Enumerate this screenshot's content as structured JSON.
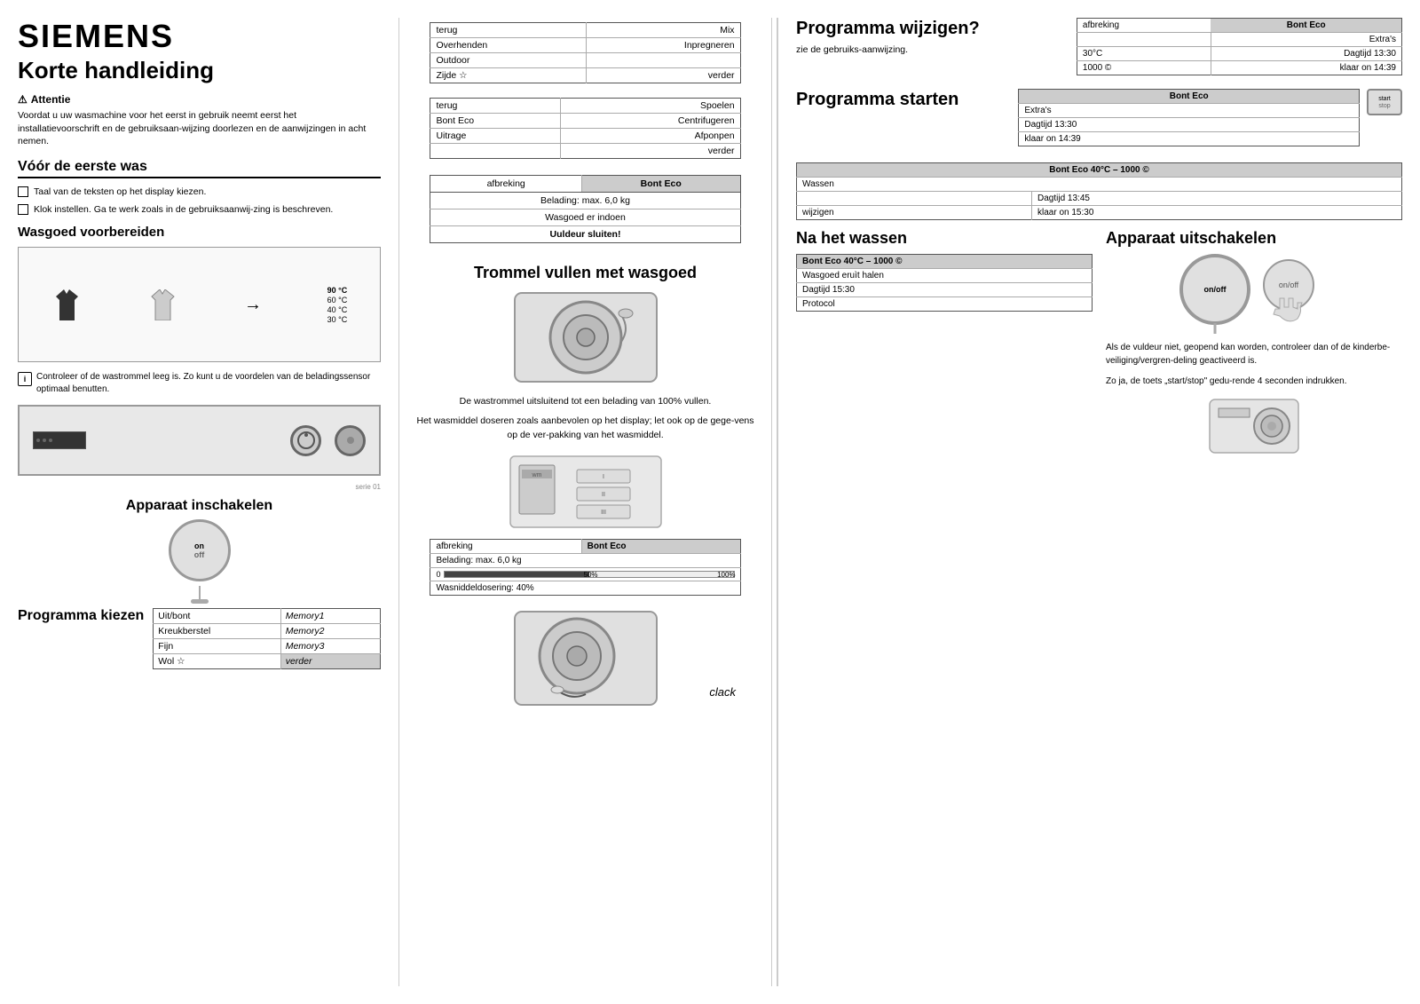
{
  "logo": "SIEMENS",
  "title": "Korte handleiding",
  "attentie": {
    "label": "Attentie",
    "text": "Voordat u uw wasmachine voor het eerst in gebruik neemt eerst het installatievoorschrift en de gebruiksaan-wijzing doorlezen en de aanwijzingen in acht nemen."
  },
  "voor_de_eerste_was": {
    "title": "Vóór de eerste was",
    "items": [
      "Taal van de teksten op het display kiezen.",
      "Klok instellen. Ga te werk zoals in de gebruiksaanwij-zing is beschreven."
    ]
  },
  "wasgoed_voorbereiden": {
    "title": "Wasgoed voorbereiden",
    "temps": [
      "90 °C",
      "60 °C",
      "40 °C",
      "30 °C"
    ],
    "control_note": "Controleer of de wastrommel leeg is. Zo kunt u de voordelen van de beladingssensor optimaal benutten."
  },
  "apparaat_inschakelen": {
    "title": "Apparaat inschakelen",
    "button_on": "on",
    "button_off": "off"
  },
  "programma_kiezen": {
    "title": "Programma kiezen",
    "rows": [
      {
        "left": "Uit/bont",
        "right": "Memory1"
      },
      {
        "left": "Kreukberstel",
        "right": "Memory2"
      },
      {
        "left": "Fijn",
        "right": "Memory3"
      },
      {
        "left": "Wol ☆",
        "right": "verder"
      }
    ]
  },
  "prog_select_top": {
    "rows": [
      {
        "left": "terug",
        "right": "Mix"
      },
      {
        "left": "Overhenden",
        "right": "Inpregneren"
      },
      {
        "left": "Outdoor",
        "right": ""
      },
      {
        "left": "Zijde ☆",
        "right": "verder"
      }
    ]
  },
  "spoelen_table": {
    "rows": [
      {
        "left": "terug",
        "right": "Spoelen"
      },
      {
        "left": "Bont Eco",
        "right": "Centrifugeren"
      },
      {
        "left": "Uitrage",
        "right": "Afponpen"
      },
      {
        "left": "",
        "right": "verder"
      }
    ]
  },
  "bonteco_info": {
    "header_left": "afbreking",
    "header_right": "Bont Eco",
    "rows": [
      "Belading: max. 6,0 kg",
      "Wasgoed er indoen",
      "Uuldeur sluiten!"
    ]
  },
  "trommel": {
    "title": "Trommel vullen met wasgoed",
    "desc": "De wastrommel uitsluitend tot een belading van 100% vullen.\n\nHet wasmiddel doseren zoals aanbevolen op het display; let ook op de gege-vens op de ver-pakking van het wasmiddel."
  },
  "dosering_table": {
    "header_left": "afbreking",
    "header_right": "Bont Eco",
    "row1": "Belading: max. 6,0 kg",
    "progress_label": "Wasniddeldosering: 40%",
    "progress_zero": "0",
    "progress_50": "50%",
    "progress_100": "100%"
  },
  "clack": "clack",
  "programma_wijzigen": {
    "title": "Programma wijzigen?",
    "subtitle": "zie de gebruiks-aanwijzing.",
    "table_header_left": "afbreking",
    "table_header_right": "Bont Eco",
    "rows": [
      {
        "left": "",
        "right": "Extra's"
      },
      {
        "left": "30°C",
        "right": "Dagtijd 13:30"
      },
      {
        "left": "1000 ©",
        "right": "klaar on 14:39"
      }
    ]
  },
  "programma_starten": {
    "title": "Programma starten",
    "header": "Bont Eco",
    "rows": [
      "Extra's",
      "Dagtijd 13:30",
      "klaar on 14:39"
    ],
    "start_label": "start",
    "stop_label": "stop"
  },
  "bonteco40": {
    "header": "Bont Eco 40°C – 1000 ©",
    "row1": "Wassen",
    "row2_left": "",
    "row2_right": "Dagtijd 13:45",
    "row3_left": "wijzigen",
    "row3_right": "klaar on 15:30"
  },
  "na_het_wassen": {
    "title": "Na het wassen",
    "table_header": "Bont Eco 40°C – 1000 ©",
    "rows": [
      "Wasgoed eruìt halen",
      "Dagtijd 15:30",
      "Protocol"
    ]
  },
  "apparaat_uitschakelen": {
    "title": "Apparaat uitschakelen",
    "button_on": "on/off",
    "desc": "Als de vuldeur niet, geopend kan worden, controleer dan of de kinderbe-veiliging/vergren-deling geactiveerd is.\n\nZo ja, de toets \"start/stop\" gedu-rende 4 seconden indrukken."
  }
}
